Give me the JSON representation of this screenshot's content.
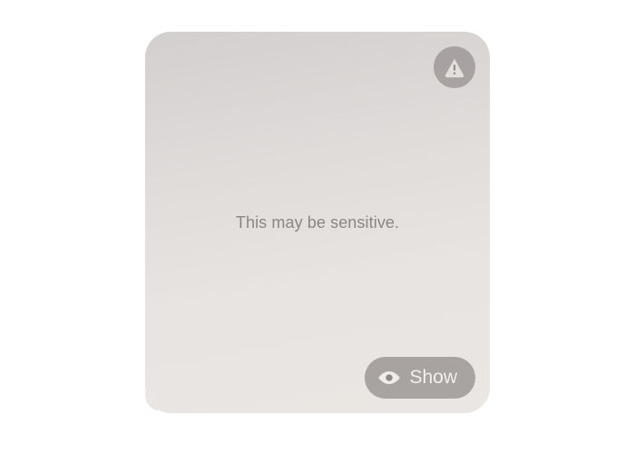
{
  "message": {
    "sensitive_label": "This may be sensitive.",
    "show_button_label": "Show"
  },
  "colors": {
    "badge_bg": "rgba(125,120,118,0.55)",
    "button_bg": "rgba(120,116,114,0.58)",
    "text": "#8a8683",
    "button_text": "#f2efed"
  }
}
